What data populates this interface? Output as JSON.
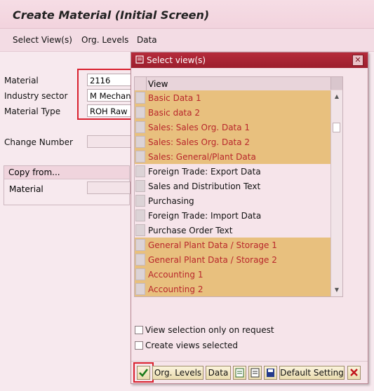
{
  "window": {
    "title": "Create Material (Initial Screen)"
  },
  "menu": [
    {
      "label": "Select View(s)"
    },
    {
      "label": "Org. Levels"
    },
    {
      "label": "Data"
    }
  ],
  "form": {
    "material": {
      "label": "Material",
      "value": "2116"
    },
    "industry_sector": {
      "label": "Industry sector",
      "value": "M Mechanic"
    },
    "material_type": {
      "label": "Material Type",
      "value": "ROH Raw m"
    },
    "change_number": {
      "label": "Change Number",
      "value": ""
    },
    "copy_from": {
      "title": "Copy from...",
      "material_label": "Material",
      "material_value": ""
    }
  },
  "dialog": {
    "title": "Select view(s)",
    "column_header": "View",
    "views": [
      {
        "label": "Basic Data 1",
        "selected": true
      },
      {
        "label": "Basic data 2",
        "selected": true
      },
      {
        "label": "Sales: Sales Org. Data 1",
        "selected": true
      },
      {
        "label": "Sales: Sales Org. Data 2",
        "selected": true
      },
      {
        "label": "Sales: General/Plant Data",
        "selected": true
      },
      {
        "label": "Foreign Trade: Export Data",
        "selected": false
      },
      {
        "label": "Sales and Distribution Text",
        "selected": false
      },
      {
        "label": "Purchasing",
        "selected": false
      },
      {
        "label": "Foreign Trade: Import Data",
        "selected": false
      },
      {
        "label": "Purchase Order Text",
        "selected": false
      },
      {
        "label": "General Plant Data / Storage 1",
        "selected": true
      },
      {
        "label": "General Plant Data / Storage 2",
        "selected": true
      },
      {
        "label": "Accounting 1",
        "selected": true
      },
      {
        "label": "Accounting 2",
        "selected": true
      }
    ],
    "options": {
      "view_on_request": {
        "label": "View selection only on request",
        "checked": false
      },
      "create_selected": {
        "label": "Create views selected",
        "checked": false
      }
    },
    "buttons": {
      "org_levels": "Org. Levels",
      "data": "Data",
      "default_setting": "Default Setting"
    }
  },
  "colors": {
    "selected_row": "#e8c07e",
    "selected_text": "#b8272b",
    "highlight": "#d9212f",
    "title_bar": "#b52b3b"
  },
  "icons": [
    "select-views-icon",
    "close-icon",
    "scroll-up-icon",
    "scroll-down-icon",
    "check-icon",
    "select-all-icon",
    "deselect-all-icon",
    "save-icon",
    "cancel-icon"
  ]
}
